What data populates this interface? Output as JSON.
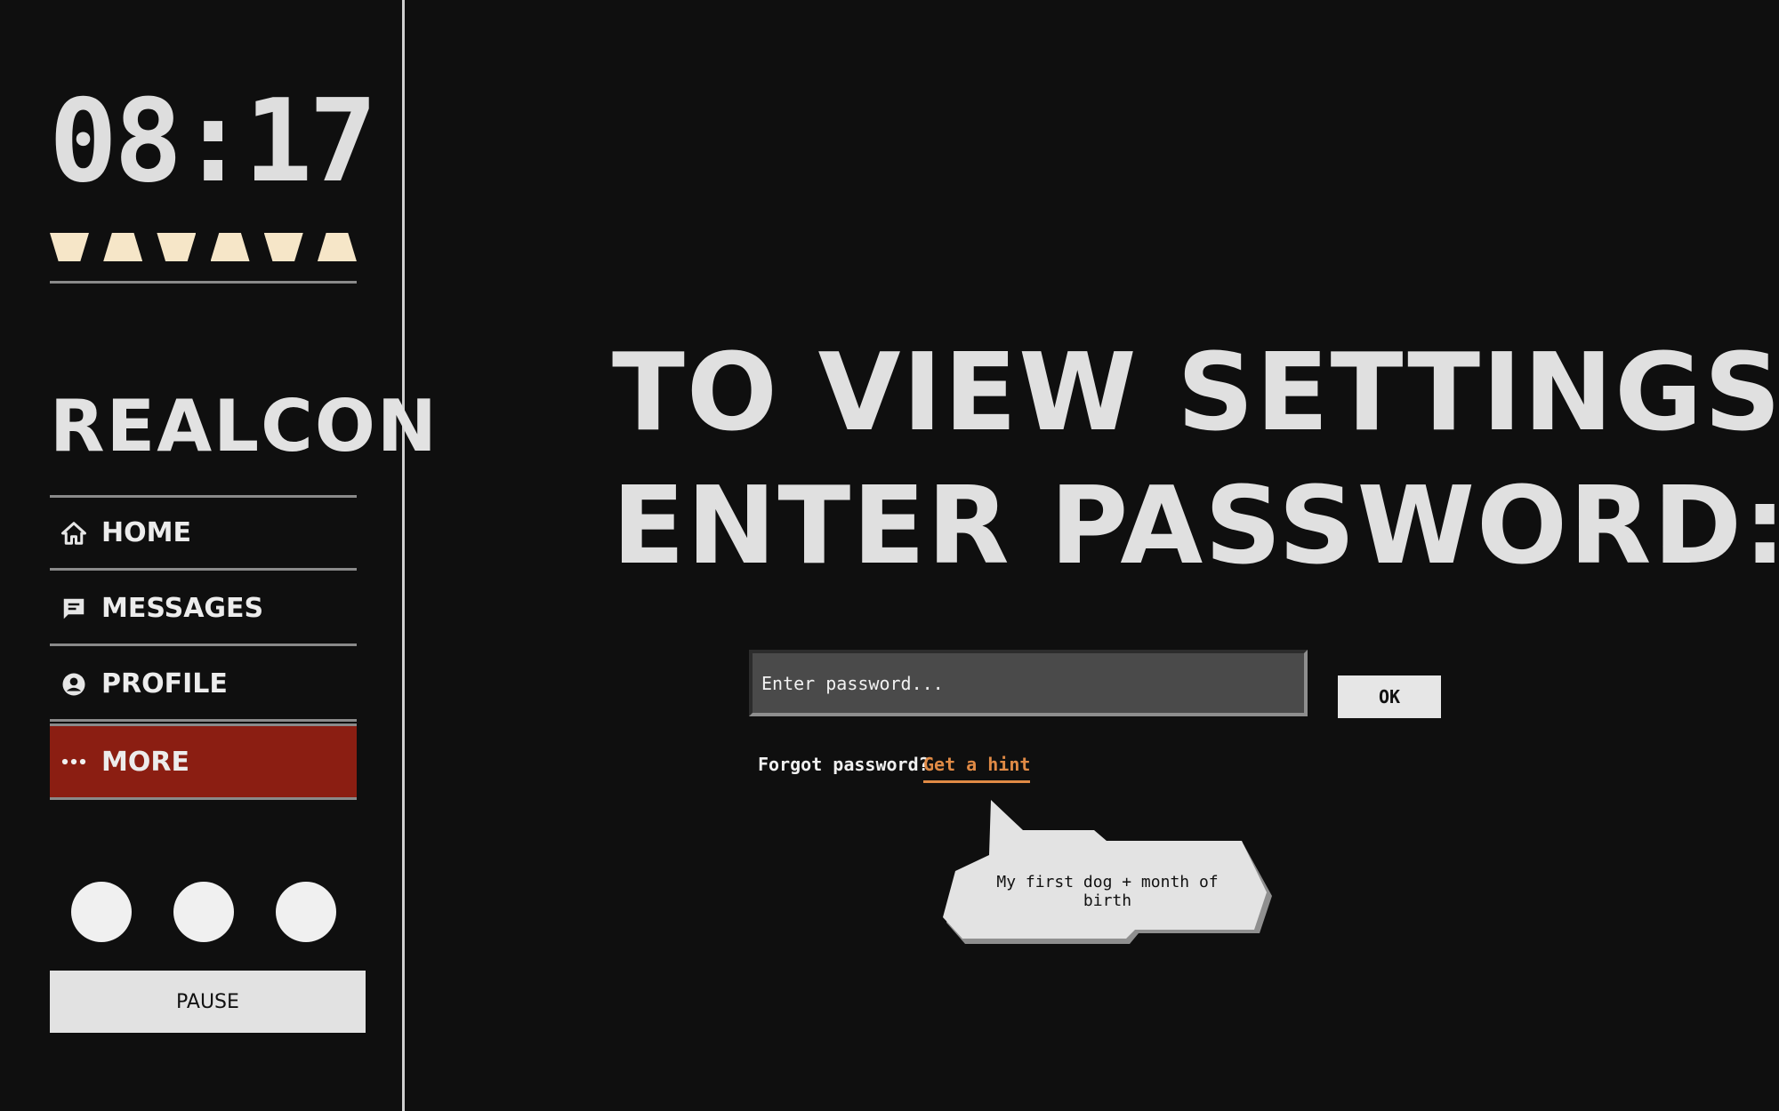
{
  "sidebar": {
    "clock": "08:17",
    "progress_segments": 6,
    "brand": "REALCON",
    "nav": [
      {
        "label": "HOME",
        "icon": "home-icon",
        "active": false
      },
      {
        "label": "MESSAGES",
        "icon": "message-icon",
        "active": false
      },
      {
        "label": "PROFILE",
        "icon": "profile-icon",
        "active": false
      },
      {
        "label": "MORE",
        "icon": "more-icon",
        "active": true
      }
    ],
    "pause_label": "PAUSE"
  },
  "main": {
    "heading_line1": "TO VIEW SETTINGS",
    "heading_line2": "ENTER PASSWORD:",
    "password_placeholder": "Enter password...",
    "ok_label": "OK",
    "forgot_text": "Forgot password?",
    "hint_link": "Get a hint",
    "hint_text": "My first dog + month of birth"
  },
  "colors": {
    "background": "#0f0f0f",
    "active_nav": "#8b1e12",
    "progress": "#f6e6c8",
    "hint_link": "#e08a45"
  }
}
